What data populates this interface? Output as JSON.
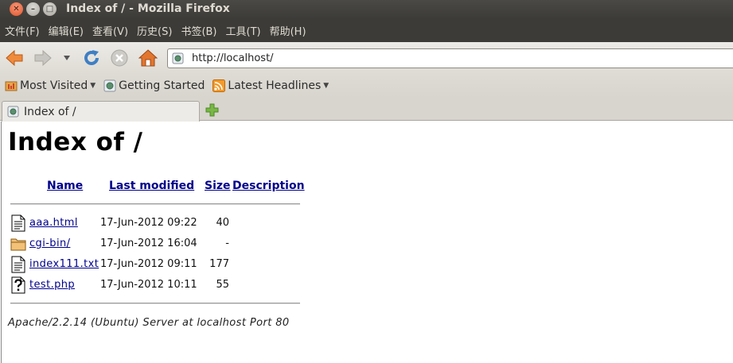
{
  "window": {
    "title": "Index of / - Mozilla Firefox"
  },
  "menu": [
    "文件(F)",
    "编辑(E)",
    "查看(V)",
    "历史(S)",
    "书签(B)",
    "工具(T)",
    "帮助(H)"
  ],
  "navbar": {
    "url": "http://localhost/"
  },
  "bookmarks": [
    {
      "label": "Most Visited",
      "has_arrow": true
    },
    {
      "label": "Getting Started",
      "has_arrow": false
    },
    {
      "label": "Latest Headlines",
      "has_arrow": true
    }
  ],
  "tab": {
    "title": "Index of /"
  },
  "page": {
    "title": "Index of /",
    "columns": {
      "name": "Name",
      "modified": "Last modified",
      "size": "Size",
      "description": "Description"
    },
    "files": [
      {
        "icon": "document-icon",
        "name": "aaa.html",
        "modified": "17-Jun-2012 09:22",
        "size": "40"
      },
      {
        "icon": "folder-icon",
        "name": "cgi-bin/",
        "modified": "17-Jun-2012 16:04",
        "size": "-"
      },
      {
        "icon": "document-icon",
        "name": "index111.txt",
        "modified": "17-Jun-2012 09:11",
        "size": "177"
      },
      {
        "icon": "unknown-file-icon",
        "name": "test.php",
        "modified": "17-Jun-2012 10:11",
        "size": "55"
      }
    ],
    "footer": "Apache/2.2.14 (Ubuntu) Server at localhost Port 80"
  }
}
